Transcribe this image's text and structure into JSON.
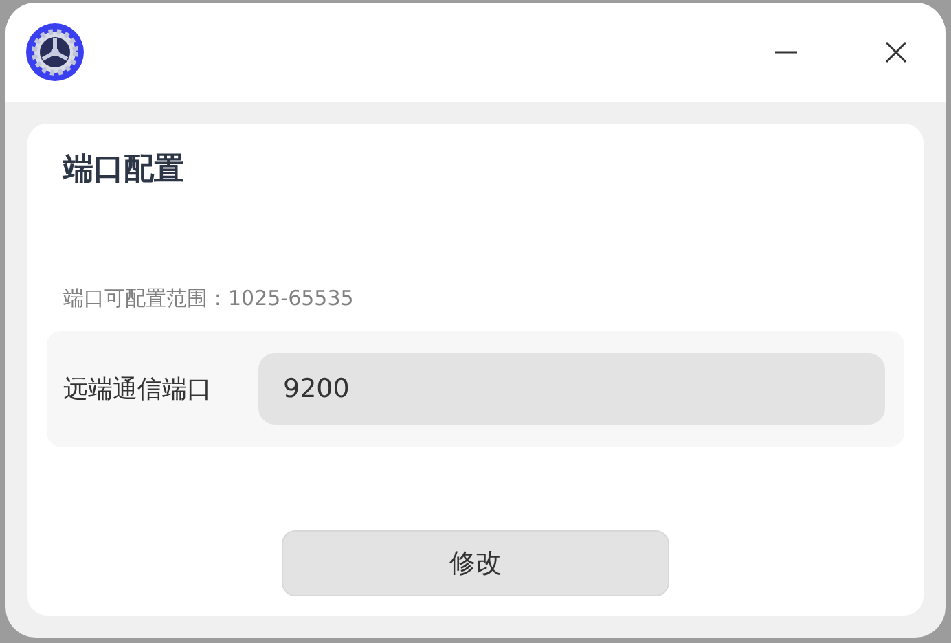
{
  "section": {
    "title": "端口配置",
    "hint": "端口可配置范围：1025-65535",
    "field": {
      "label": "远端通信端口",
      "value": "9200"
    },
    "button": "修改"
  }
}
